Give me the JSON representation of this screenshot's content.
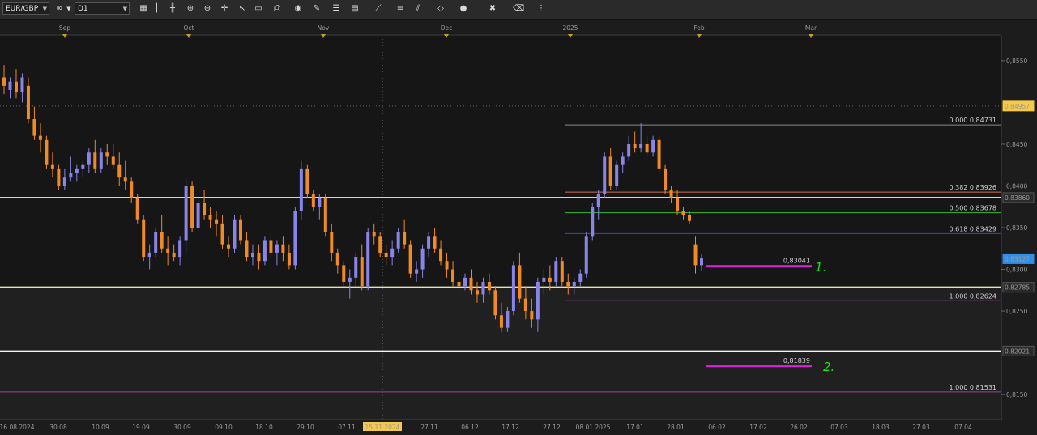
{
  "toolbar": {
    "symbol": "EUR/GBP",
    "period": "D1",
    "icons": [
      "chart-type-icon",
      "bar-style-icon",
      "candle-style-icon",
      "zoom-in-icon",
      "zoom-out-icon",
      "crosshair-icon",
      "cursor-icon",
      "template-icon",
      "print-icon",
      "screenshot-icon",
      "pencil-icon",
      "indicators-icon",
      "objects-icon",
      "trend-icon",
      "lines-icon",
      "fibo-icon",
      "shapes-icon",
      "color-icon",
      "delete-icon",
      "eraser-icon",
      "more-icon"
    ]
  },
  "colors": {
    "background": "#1c1c1c",
    "plot_bg": "#161616",
    "bull": "#8884e8",
    "bear": "#f08a24",
    "price_hl": "#f7c948",
    "current_price_bg": "#2f8fe8",
    "magenta": "#e020e0",
    "green_mark": "#22dd22",
    "fib_level_000": "#8a8a8a",
    "fib_level_382": "#d07050",
    "fib_level_500": "#3ab83a",
    "fib_level_618": "#3a44d8",
    "fib_level_100": "#a04090"
  },
  "chart_data": {
    "type": "candlestick",
    "instrument": "EUR/GBP",
    "timeframe": "D1",
    "y_range": [
      0.812,
      0.858
    ],
    "y_ticks": [
      "0,8550",
      "0,8450",
      "0,8400",
      "0,8350",
      "0,8300",
      "0,8250",
      "0,8150"
    ],
    "x_tick_labels": [
      "16.08.2024",
      "30.08",
      "10.09",
      "19.09",
      "30.09",
      "09.10",
      "18.10",
      "29.10",
      "07.11",
      "15.11.2024",
      "27.11",
      "06.12",
      "17.12",
      "27.12",
      "08.01.2025",
      "17.01",
      "28.01",
      "06.02",
      "17.02",
      "26.02",
      "07.03",
      "18.03",
      "27.03",
      "07.04"
    ],
    "highlighted_date": "15.11.2024",
    "month_markers": [
      "Sep",
      "Oct",
      "Nov",
      "Dec",
      "2025",
      "Feb",
      "Mar"
    ],
    "price_labels": [
      {
        "value": "0,84957",
        "style": "highlight"
      },
      {
        "value": "0,83860",
        "style": "dark"
      },
      {
        "value": "0,83127",
        "style": "current"
      },
      {
        "value": "0,82785",
        "style": "dark"
      },
      {
        "value": "0,82021",
        "style": "dark"
      }
    ],
    "horizontal_lines": [
      {
        "price": 0.8386,
        "color": "white"
      },
      {
        "price": 0.82785,
        "color": "cream"
      },
      {
        "price": 0.82021,
        "color": "white"
      },
      {
        "price": 0.84957,
        "color": "dotted"
      }
    ],
    "fibo_levels": [
      {
        "label": "0,000 0,84731",
        "price": 0.84731,
        "color": "#8a8a8a"
      },
      {
        "label": "0,382 0,83926",
        "price": 0.83926,
        "color": "#d07050"
      },
      {
        "label": "0,500 0,83678",
        "price": 0.83678,
        "color": "#3ab83a"
      },
      {
        "label": "0,618 0,83429",
        "price": 0.83429,
        "color": "#3a44d8"
      },
      {
        "label": "1,000 0,82624",
        "price": 0.82624,
        "color": "#a04090"
      }
    ],
    "fibo_levels_lower": [
      {
        "label": "1,000 0,81531",
        "price": 0.81531,
        "color": "#a04090"
      }
    ],
    "targets": [
      {
        "label": "0,83041",
        "price": 0.83041,
        "marker": "1."
      },
      {
        "label": "0,81839",
        "price": 0.81839,
        "marker": "2."
      }
    ],
    "candles": [
      [
        0.853,
        0.8545,
        0.851,
        0.852
      ],
      [
        0.8515,
        0.853,
        0.8505,
        0.8525
      ],
      [
        0.8525,
        0.854,
        0.8505,
        0.8512
      ],
      [
        0.8512,
        0.8535,
        0.85,
        0.853
      ],
      [
        0.852,
        0.853,
        0.8475,
        0.848
      ],
      [
        0.848,
        0.8495,
        0.8455,
        0.846
      ],
      [
        0.846,
        0.8475,
        0.844,
        0.8455
      ],
      [
        0.8455,
        0.846,
        0.842,
        0.8425
      ],
      [
        0.8425,
        0.844,
        0.841,
        0.842
      ],
      [
        0.842,
        0.8425,
        0.8395,
        0.84
      ],
      [
        0.84,
        0.842,
        0.8395,
        0.841
      ],
      [
        0.841,
        0.8435,
        0.8405,
        0.8415
      ],
      [
        0.8415,
        0.8425,
        0.8405,
        0.842
      ],
      [
        0.842,
        0.843,
        0.841,
        0.8425
      ],
      [
        0.8425,
        0.8445,
        0.8415,
        0.844
      ],
      [
        0.844,
        0.8455,
        0.8415,
        0.842
      ],
      [
        0.842,
        0.8445,
        0.8415,
        0.844
      ],
      [
        0.844,
        0.845,
        0.8425,
        0.8435
      ],
      [
        0.8435,
        0.845,
        0.842,
        0.8425
      ],
      [
        0.8425,
        0.844,
        0.84,
        0.841
      ],
      [
        0.841,
        0.843,
        0.8395,
        0.8405
      ],
      [
        0.8405,
        0.841,
        0.838,
        0.8385
      ],
      [
        0.8385,
        0.839,
        0.8355,
        0.836
      ],
      [
        0.836,
        0.8365,
        0.831,
        0.8315
      ],
      [
        0.8315,
        0.833,
        0.83,
        0.832
      ],
      [
        0.832,
        0.835,
        0.8315,
        0.8345
      ],
      [
        0.8345,
        0.8365,
        0.832,
        0.8325
      ],
      [
        0.8325,
        0.834,
        0.8305,
        0.832
      ],
      [
        0.832,
        0.833,
        0.831,
        0.8315
      ],
      [
        0.8315,
        0.834,
        0.8305,
        0.8335
      ],
      [
        0.8335,
        0.841,
        0.832,
        0.84
      ],
      [
        0.84,
        0.8405,
        0.8345,
        0.835
      ],
      [
        0.835,
        0.8385,
        0.8345,
        0.838
      ],
      [
        0.838,
        0.8395,
        0.836,
        0.8365
      ],
      [
        0.8365,
        0.8375,
        0.835,
        0.836
      ],
      [
        0.836,
        0.837,
        0.834,
        0.8355
      ],
      [
        0.8355,
        0.8365,
        0.8325,
        0.833
      ],
      [
        0.833,
        0.834,
        0.8315,
        0.8325
      ],
      [
        0.8325,
        0.8365,
        0.832,
        0.836
      ],
      [
        0.836,
        0.8365,
        0.833,
        0.8335
      ],
      [
        0.8335,
        0.8345,
        0.831,
        0.8315
      ],
      [
        0.8315,
        0.833,
        0.8305,
        0.832
      ],
      [
        0.832,
        0.833,
        0.83,
        0.831
      ],
      [
        0.831,
        0.834,
        0.8305,
        0.8335
      ],
      [
        0.8335,
        0.8345,
        0.8315,
        0.832
      ],
      [
        0.832,
        0.8335,
        0.8305,
        0.833
      ],
      [
        0.833,
        0.834,
        0.831,
        0.832
      ],
      [
        0.832,
        0.833,
        0.83,
        0.8305
      ],
      [
        0.8305,
        0.8375,
        0.83,
        0.837
      ],
      [
        0.837,
        0.843,
        0.836,
        0.842
      ],
      [
        0.842,
        0.8425,
        0.8385,
        0.839
      ],
      [
        0.839,
        0.8395,
        0.837,
        0.8375
      ],
      [
        0.8375,
        0.839,
        0.836,
        0.8385
      ],
      [
        0.8385,
        0.839,
        0.834,
        0.8345
      ],
      [
        0.8345,
        0.8355,
        0.831,
        0.832
      ],
      [
        0.832,
        0.8325,
        0.8295,
        0.8305
      ],
      [
        0.8305,
        0.831,
        0.828,
        0.8285
      ],
      [
        0.8285,
        0.83,
        0.8265,
        0.829
      ],
      [
        0.829,
        0.832,
        0.828,
        0.8315
      ],
      [
        0.8315,
        0.833,
        0.8275,
        0.828
      ],
      [
        0.828,
        0.835,
        0.8275,
        0.8345
      ],
      [
        0.8345,
        0.8355,
        0.833,
        0.834
      ],
      [
        0.834,
        0.8345,
        0.8315,
        0.832
      ],
      [
        0.832,
        0.833,
        0.8305,
        0.8315
      ],
      [
        0.8315,
        0.8335,
        0.8305,
        0.8325
      ],
      [
        0.8325,
        0.835,
        0.832,
        0.8345
      ],
      [
        0.8345,
        0.836,
        0.8325,
        0.833
      ],
      [
        0.833,
        0.8335,
        0.829,
        0.8295
      ],
      [
        0.8295,
        0.831,
        0.8285,
        0.83
      ],
      [
        0.83,
        0.833,
        0.829,
        0.8325
      ],
      [
        0.8325,
        0.8345,
        0.8315,
        0.834
      ],
      [
        0.834,
        0.835,
        0.832,
        0.8325
      ],
      [
        0.8325,
        0.8335,
        0.8305,
        0.831
      ],
      [
        0.831,
        0.832,
        0.829,
        0.83
      ],
      [
        0.83,
        0.831,
        0.828,
        0.8285
      ],
      [
        0.8285,
        0.83,
        0.827,
        0.828
      ],
      [
        0.828,
        0.8295,
        0.8275,
        0.829
      ],
      [
        0.829,
        0.83,
        0.827,
        0.8275
      ],
      [
        0.8275,
        0.8285,
        0.826,
        0.827
      ],
      [
        0.827,
        0.829,
        0.826,
        0.8285
      ],
      [
        0.8285,
        0.8295,
        0.827,
        0.8275
      ],
      [
        0.8275,
        0.828,
        0.824,
        0.8245
      ],
      [
        0.8245,
        0.826,
        0.8225,
        0.823
      ],
      [
        0.823,
        0.8255,
        0.8225,
        0.825
      ],
      [
        0.825,
        0.831,
        0.8245,
        0.8305
      ],
      [
        0.8305,
        0.832,
        0.826,
        0.8265
      ],
      [
        0.8265,
        0.828,
        0.824,
        0.825
      ],
      [
        0.825,
        0.8265,
        0.823,
        0.824
      ],
      [
        0.824,
        0.829,
        0.8225,
        0.8285
      ],
      [
        0.8285,
        0.83,
        0.827,
        0.829
      ],
      [
        0.829,
        0.8305,
        0.8275,
        0.8285
      ],
      [
        0.8285,
        0.8315,
        0.828,
        0.831
      ],
      [
        0.831,
        0.8315,
        0.828,
        0.8285
      ],
      [
        0.8285,
        0.8295,
        0.827,
        0.828
      ],
      [
        0.828,
        0.829,
        0.827,
        0.8285
      ],
      [
        0.8285,
        0.83,
        0.828,
        0.8295
      ],
      [
        0.8295,
        0.8345,
        0.829,
        0.834
      ],
      [
        0.834,
        0.838,
        0.8335,
        0.8375
      ],
      [
        0.8375,
        0.8395,
        0.836,
        0.839
      ],
      [
        0.839,
        0.844,
        0.8385,
        0.8435
      ],
      [
        0.8435,
        0.8445,
        0.8395,
        0.84
      ],
      [
        0.84,
        0.843,
        0.8395,
        0.8425
      ],
      [
        0.8425,
        0.844,
        0.8415,
        0.8435
      ],
      [
        0.8435,
        0.846,
        0.843,
        0.845
      ],
      [
        0.845,
        0.8465,
        0.844,
        0.8445
      ],
      [
        0.8445,
        0.8475,
        0.844,
        0.845
      ],
      [
        0.845,
        0.846,
        0.8435,
        0.844
      ],
      [
        0.844,
        0.846,
        0.8435,
        0.8455
      ],
      [
        0.8455,
        0.846,
        0.8415,
        0.842
      ],
      [
        0.842,
        0.8425,
        0.839,
        0.8395
      ],
      [
        0.8395,
        0.84,
        0.838,
        0.8385
      ],
      [
        0.8385,
        0.8395,
        0.8365,
        0.837
      ],
      [
        0.837,
        0.8375,
        0.836,
        0.8365
      ],
      [
        0.8365,
        0.837,
        0.8355,
        0.8358
      ],
      [
        0.833,
        0.834,
        0.8295,
        0.8305
      ],
      [
        0.8305,
        0.8318,
        0.8298,
        0.8313
      ]
    ]
  }
}
